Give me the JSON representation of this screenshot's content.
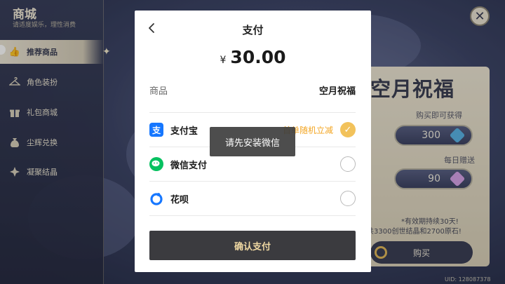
{
  "shop": {
    "title": "商城",
    "subtitle": "请适度娱乐，理性消费",
    "nav": [
      {
        "label": "推荐商品",
        "icon": "thumbs-up-icon",
        "active": true
      },
      {
        "label": "角色装扮",
        "icon": "hanger-icon",
        "active": false
      },
      {
        "label": "礼包商城",
        "icon": "gift-icon",
        "active": false
      },
      {
        "label": "尘辉兑换",
        "icon": "coin-bag-icon",
        "active": false
      },
      {
        "label": "凝聚结晶",
        "icon": "crystal-icon",
        "active": false
      }
    ]
  },
  "card": {
    "title": "空月祝福",
    "buy_label": "购买即可获得",
    "buy_amount": "300",
    "daily_label": "每日赠送",
    "daily_amount": "90",
    "note_line1": "*有效期持续30天!",
    "note_line2": "共3300创世结晶和2700原石!",
    "buy_button": "购买"
  },
  "uid": "UID: 128087378",
  "dialog": {
    "title": "支付",
    "currency": "¥",
    "amount": "30.00",
    "goods_label": "商品",
    "goods_value": "空月祝福",
    "methods": [
      {
        "name": "支付宝",
        "promo": "首单随机立减",
        "selected": true,
        "color": "#1677ff"
      },
      {
        "name": "微信支付",
        "promo": "",
        "selected": false,
        "color": "#07c160"
      },
      {
        "name": "花呗",
        "promo": "",
        "selected": false,
        "color": "#1677ff"
      }
    ],
    "confirm_button": "确认支付"
  },
  "toast": "请先安装微信",
  "colors": {
    "accent_gold": "#f2c25b",
    "promo_orange": "#f3a623",
    "confirm_bg": "#3b3b3f"
  }
}
